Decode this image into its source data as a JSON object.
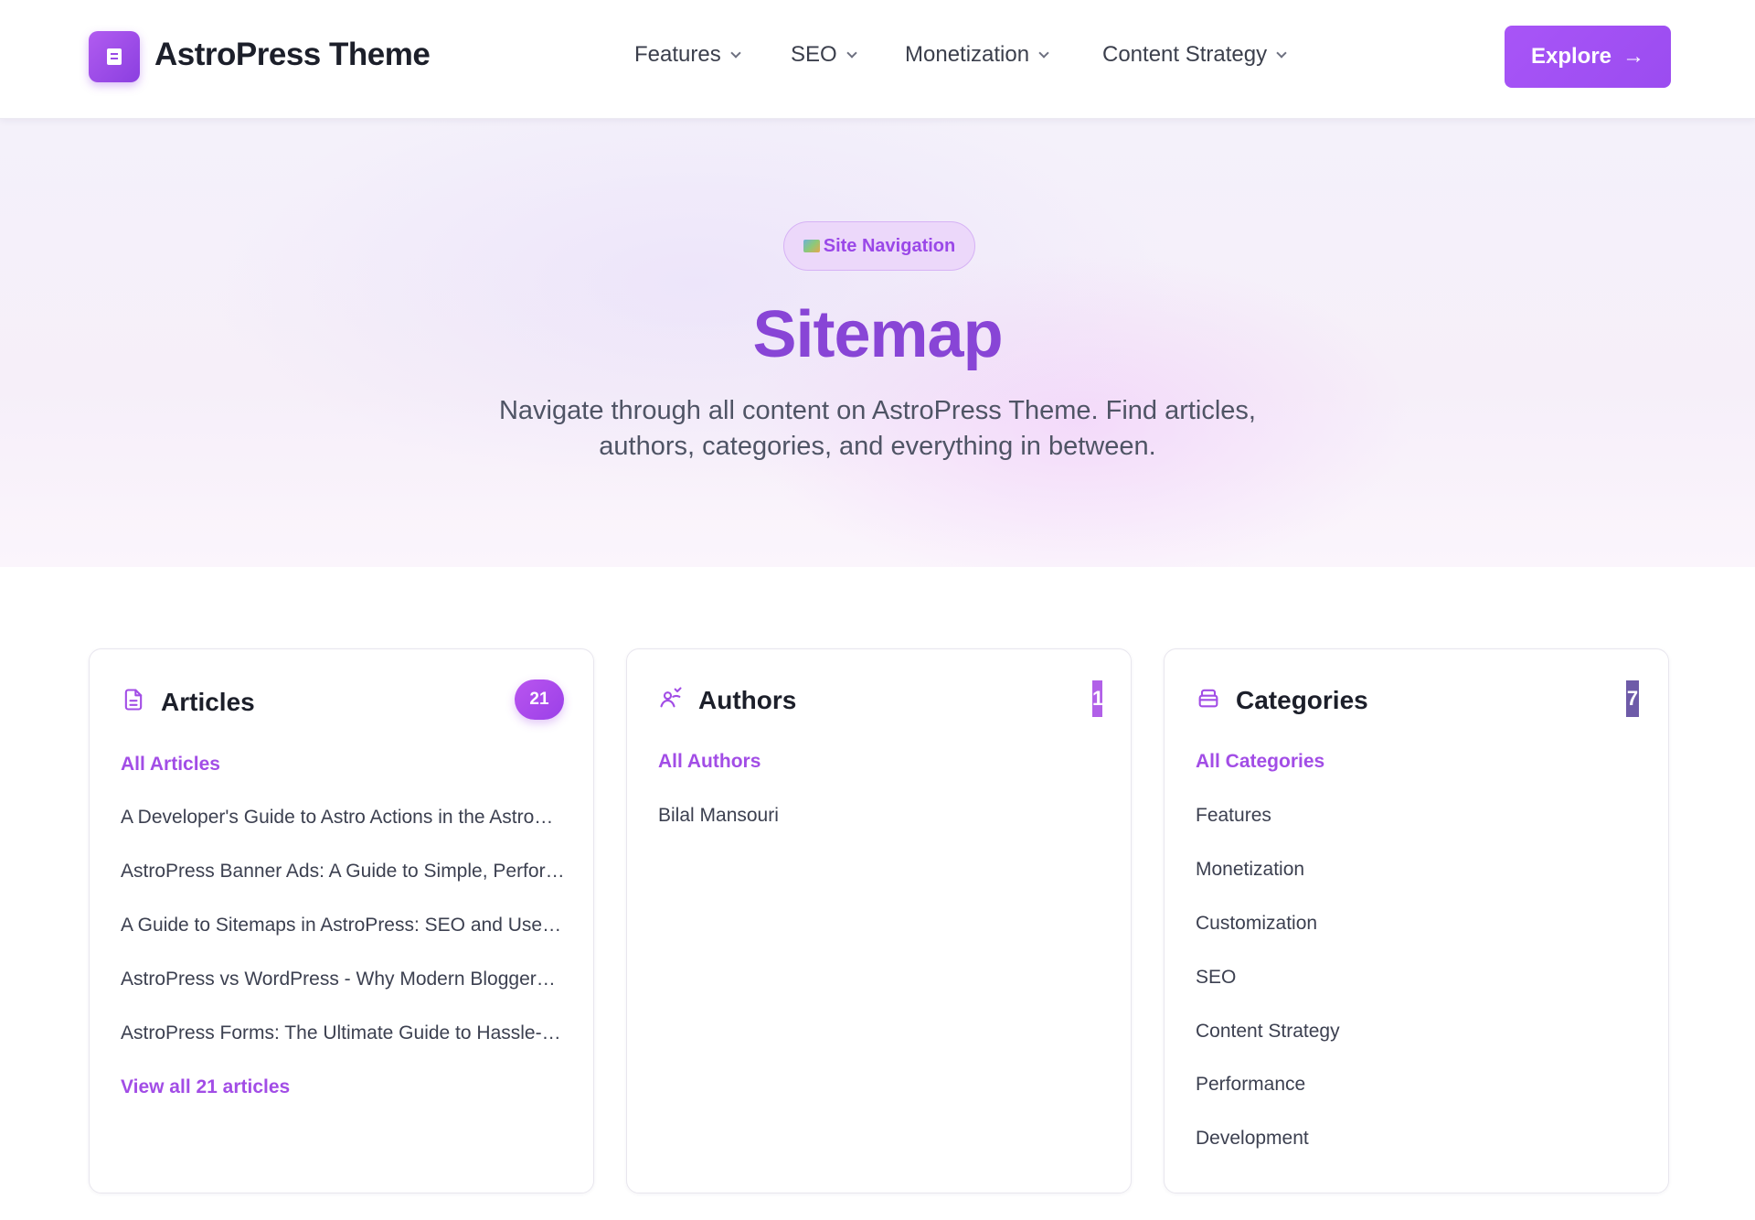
{
  "header": {
    "brand": "AstroPress Theme",
    "nav": [
      {
        "label": "Features"
      },
      {
        "label": "SEO"
      },
      {
        "label": "Monetization"
      },
      {
        "label": "Content Strategy"
      }
    ],
    "cta_label": "Explore",
    "cta_arrow": "→"
  },
  "hero": {
    "badge": "Site Navigation",
    "title": "Sitemap",
    "subtitle": "Navigate through all content on AstroPress Theme. Find articles, authors, categories, and everything in between."
  },
  "cards": {
    "articles": {
      "title": "Articles",
      "count": "21",
      "all_link": "All Articles",
      "items": [
        "A Developer's Guide to Astro Actions in the AstroPress Theme",
        "AstroPress Banner Ads: A Guide to Simple, Performant Ads",
        "A Guide to Sitemaps in AstroPress: SEO and User Navigation",
        "AstroPress vs WordPress - Why Modern Bloggers Are Switching",
        "AstroPress Forms: The Ultimate Guide to Hassle-Free Forms"
      ],
      "view_all": "View all 21 articles"
    },
    "authors": {
      "title": "Authors",
      "count": "1",
      "all_link": "All Authors",
      "items": [
        "Bilal Mansouri"
      ]
    },
    "categories": {
      "title": "Categories",
      "count": "7",
      "all_link": "All Categories",
      "items": [
        "Features",
        "Monetization",
        "Customization",
        "SEO",
        "Content Strategy",
        "Performance",
        "Development"
      ]
    }
  },
  "colors": {
    "accent": "#a855f7",
    "title": "#8845d6",
    "link": "#a24de6"
  }
}
